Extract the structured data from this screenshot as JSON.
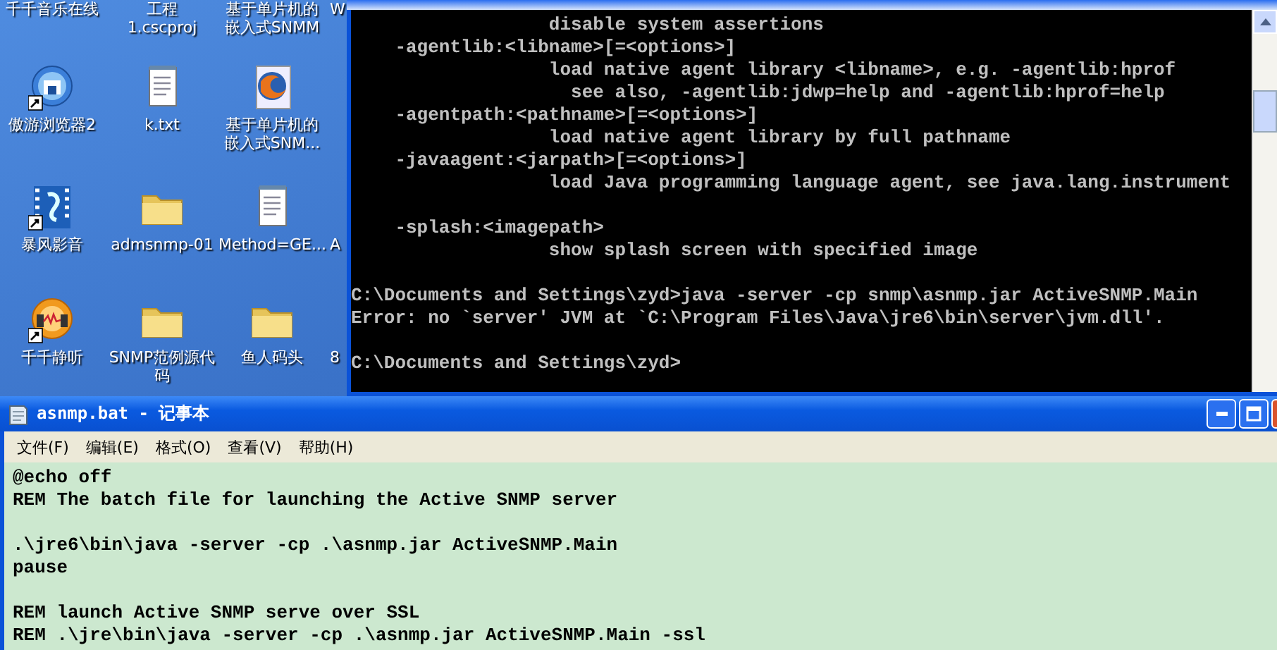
{
  "desktop": {
    "rows": [
      {
        "icons": [
          {
            "label": "千千音乐在线"
          },
          {
            "label": "工程\n1.cscproj"
          },
          {
            "label": "基于单片机的嵌入式SNMM"
          }
        ],
        "edge": "W"
      },
      {
        "icons": [
          {
            "label": "傲游浏览器2",
            "kind": "browser",
            "shortcut": true
          },
          {
            "label": "k.txt",
            "kind": "notepad"
          },
          {
            "label": "基于单片机的嵌入式SNM...",
            "kind": "firefox"
          }
        ]
      },
      {
        "icons": [
          {
            "label": "暴风影音",
            "kind": "media",
            "shortcut": true
          },
          {
            "label": "admsnmp-01",
            "kind": "folder"
          },
          {
            "label": "Method=GE...",
            "kind": "notepad"
          }
        ],
        "edge": "A"
      },
      {
        "icons": [
          {
            "label": "千千静听",
            "kind": "music",
            "shortcut": true
          },
          {
            "label": "SNMP范例源代码",
            "kind": "folder"
          },
          {
            "label": "鱼人码头",
            "kind": "folder"
          }
        ],
        "edge": "8"
      }
    ]
  },
  "console": {
    "blocks": [
      [
        "                  disable system assertions",
        "    -agentlib:<libname>[=<options>]",
        "                  load native agent library <libname>, e.g. -agentlib:hprof",
        "                    see also, -agentlib:jdwp=help and -agentlib:hprof=help",
        "    -agentpath:<pathname>[=<options>]",
        "                  load native agent library by full pathname",
        "    -javaagent:<jarpath>[=<options>]",
        "                  load Java programming language agent, see java.lang.instrument"
      ],
      [
        "    -splash:<imagepath>",
        "                  show splash screen with specified image"
      ],
      [
        "C:\\Documents and Settings\\zyd>java -server -cp snmp\\asnmp.jar ActiveSNMP.Main",
        "Error: no `server' JVM at `C:\\Program Files\\Java\\jre6\\bin\\server\\jvm.dll'."
      ],
      [
        "C:\\Documents and Settings\\zyd>"
      ]
    ]
  },
  "notepad": {
    "title": "asnmp.bat - 记事本",
    "menu": [
      "文件(F)",
      "编辑(E)",
      "格式(O)",
      "查看(V)",
      "帮助(H)"
    ],
    "blocks": [
      [
        "@echo off",
        "REM The batch file for launching the Active SNMP server"
      ],
      [
        ".\\jre6\\bin\\java -server -cp .\\asnmp.jar ActiveSNMP.Main",
        "pause"
      ],
      [
        "REM launch Active SNMP serve over SSL",
        "REM .\\jre\\bin\\java -server -cp .\\asnmp.jar ActiveSNMP.Main -ssl"
      ]
    ]
  }
}
